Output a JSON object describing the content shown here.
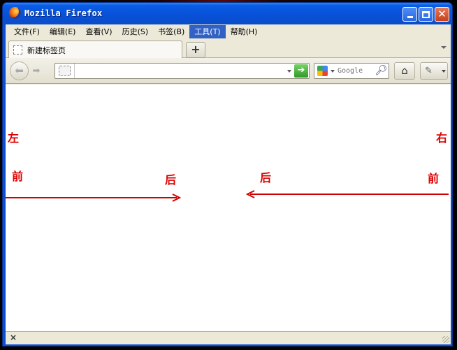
{
  "window": {
    "title": "Mozilla Firefox"
  },
  "menubar": {
    "items": [
      {
        "label": "文件(F)"
      },
      {
        "label": "编辑(E)"
      },
      {
        "label": "查看(V)"
      },
      {
        "label": "历史(S)"
      },
      {
        "label": "书签(B)"
      },
      {
        "label": "工具(T)"
      },
      {
        "label": "帮助(H)"
      }
    ],
    "active_item": "工具(T)"
  },
  "tabs": {
    "items": [
      {
        "label": "新建标签页"
      }
    ],
    "new_tab_symbol": "+"
  },
  "navbar": {
    "url": "",
    "search_placeholder": "Google",
    "search_engine_icon": "google-icon",
    "home_icon": "home-icon"
  },
  "content": {
    "labels": {
      "left": "左",
      "right": "右",
      "front_left": "前",
      "back_left": "后",
      "back_right": "后",
      "front_right": "前"
    },
    "arrow_color": "#d00000"
  },
  "statusbar": {
    "close_symbol": "×"
  },
  "colors": {
    "titlebar": "#0a5ce6",
    "menu_active": "#3161c5",
    "chrome": "#ece9d8"
  }
}
